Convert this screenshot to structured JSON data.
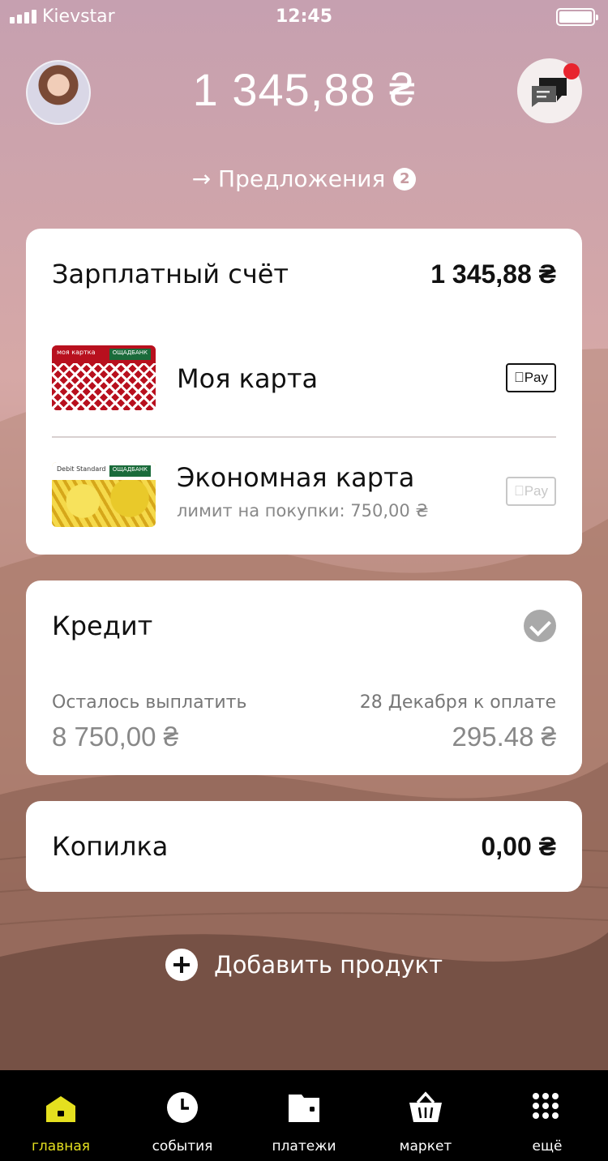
{
  "status_bar": {
    "carrier": "Kievstar",
    "time": "12:45"
  },
  "header": {
    "balance": "1 345,88 ₴",
    "offers_label": "→ Предложения",
    "offers_count": "2"
  },
  "salary_account": {
    "title": "Зарплатный счёт",
    "amount": "1 345,88 ₴",
    "cards": [
      {
        "name": "Моя карта",
        "sublabel": "",
        "apple_pay": "Pay",
        "apple_pay_enabled": true,
        "card_text": "моя картка",
        "bank": "ОЩАДБАНК"
      },
      {
        "name": "Экономная карта",
        "sublabel": "лимит на покупки: 750,00 ₴",
        "apple_pay": "Pay",
        "apple_pay_enabled": false,
        "card_text": "Debit Standard",
        "bank": "ОЩАДБАНК"
      }
    ]
  },
  "credit": {
    "title": "Кредит",
    "remaining_label": "Осталось выплатить",
    "remaining_value": "8 750,00 ₴",
    "due_label": "28 Декабря к оплате",
    "due_value": "295.48 ₴"
  },
  "piggy_bank": {
    "title": "Копилка",
    "amount": "0,00 ₴"
  },
  "add_product_label": "Добавить продукт",
  "tabs": [
    {
      "label": "главная",
      "icon": "home-icon",
      "active": true
    },
    {
      "label": "события",
      "icon": "clock-icon",
      "active": false
    },
    {
      "label": "платежи",
      "icon": "wallet-icon",
      "active": false
    },
    {
      "label": "маркет",
      "icon": "basket-icon",
      "active": false
    },
    {
      "label": "ещё",
      "icon": "grid-dots-icon",
      "active": false
    }
  ],
  "colors": {
    "accent": "#e5e01f",
    "notification": "#e8242e",
    "tabbar": "#000000"
  }
}
